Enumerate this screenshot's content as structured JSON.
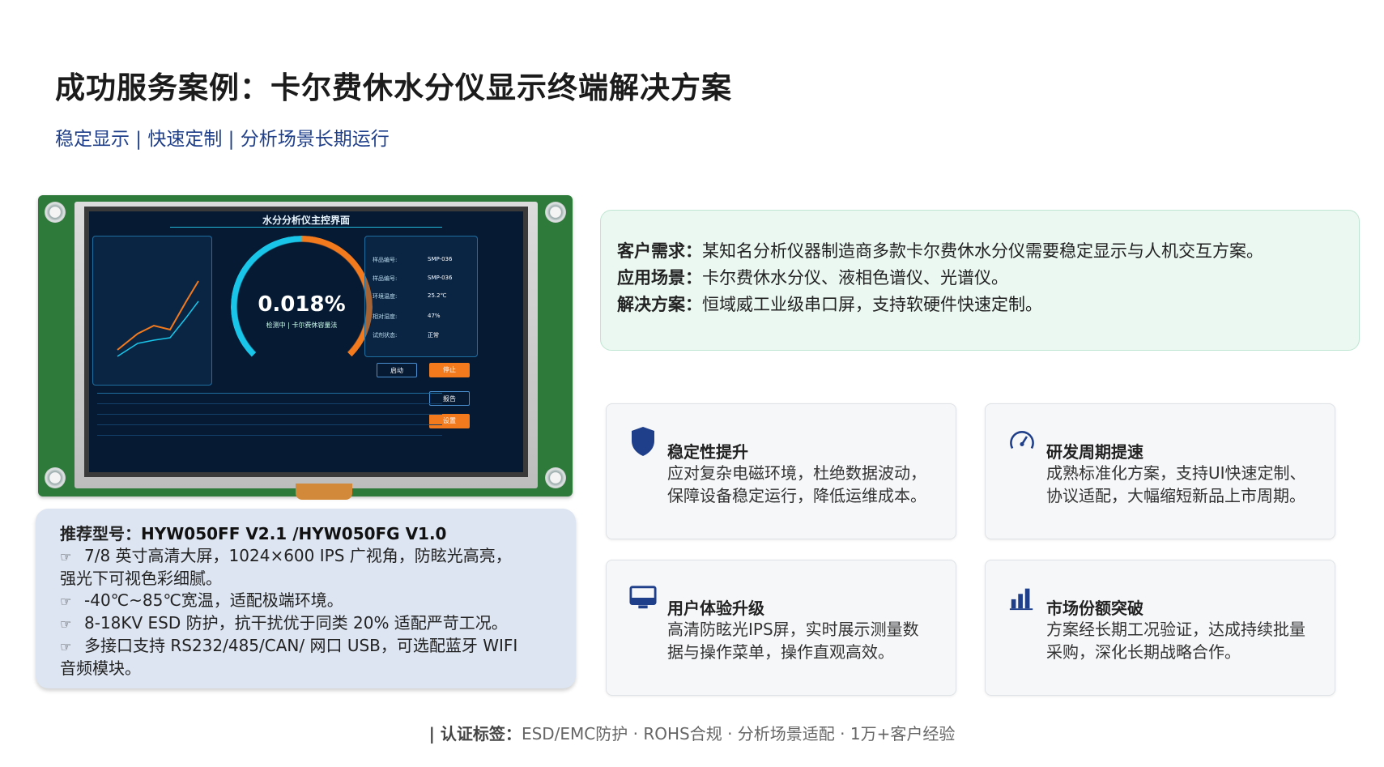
{
  "title": "成功服务案例：卡尔费休水分仪显示终端解决方案",
  "subtitle": "稳定显示 | 快速定制 | 分析场景长期运行",
  "device": {
    "lcd_title": "水分分析仪主控界面",
    "gauge_value": "0.018%",
    "gauge_sub": "检测中 | 卡尔费休容量法",
    "btn_start": "启动",
    "btn_stop": "停止",
    "btn_report": "报告",
    "btn_settings": "设置",
    "params": [
      {
        "label": "样品编号:",
        "value": "SMP-036"
      },
      {
        "label": "样品编号:",
        "value": "SMP-036"
      },
      {
        "label": "环境温度:",
        "value": "25.2℃"
      },
      {
        "label": "相对湿度:",
        "value": "47%"
      },
      {
        "label": "试剂状态:",
        "value": "正常"
      }
    ],
    "colors": {
      "pcb": "#2d7a3a",
      "cyan": "#19c5e8",
      "orange": "#f37a1d"
    }
  },
  "spec": {
    "model_label": "推荐型号：",
    "model_value": "HYW050FF V2.1 /HYW050FG V1.0",
    "items": [
      "7/8 英寸高清大屏，1024×600 IPS 广视角，防眩光高亮，",
      "强光下可视色彩细腻。",
      "-40℃~85℃宽温，适配极端环境。",
      "8-18KV ESD 防护，抗干扰优于同类 20% 适配严苛工况。",
      "多接口支持 RS232/485/CAN/ 网口 USB，可选配蓝牙 WIFI",
      "音频模块。"
    ]
  },
  "requirement": {
    "rows": [
      {
        "label": "客户需求：",
        "text": "某知名分析仪器制造商多款卡尔费休水分仪需要稳定显示与人机交互方案。"
      },
      {
        "label": "应用场景：",
        "text": "卡尔费休水分仪、液相色谱仪、光谱仪。"
      },
      {
        "label": "解决方案：",
        "text": "恒域威工业级串口屏，支持软硬件快速定制。"
      }
    ]
  },
  "cards": [
    {
      "icon": "shield-icon",
      "title": "稳定性提升",
      "line1": "应对复杂电磁环境，杜绝数据波动，",
      "line2": "保障设备稳定运行，降低运维成本。"
    },
    {
      "icon": "speedometer-icon",
      "title": "研发周期提速",
      "line1": "成熟标准化方案，支持UI快速定制、",
      "line2": "协议适配，大幅缩短新品上市周期。"
    },
    {
      "icon": "monitor-icon",
      "title": "用户体验升级",
      "line1": "高清防眩光IPS屏，实时展示测量数",
      "line2": "据与操作菜单，操作直观高效。"
    },
    {
      "icon": "bar-chart-icon",
      "title": "市场份额突破",
      "line1": "方案经长期工况验证，达成持续批量",
      "line2": "采购，深化长期战略合作。"
    }
  ],
  "certs": {
    "label": "| 认证标签：",
    "items": "ESD/EMC防护  ·  ROHS合规  ·  分析场景适配  ·  1万+客户经验"
  }
}
